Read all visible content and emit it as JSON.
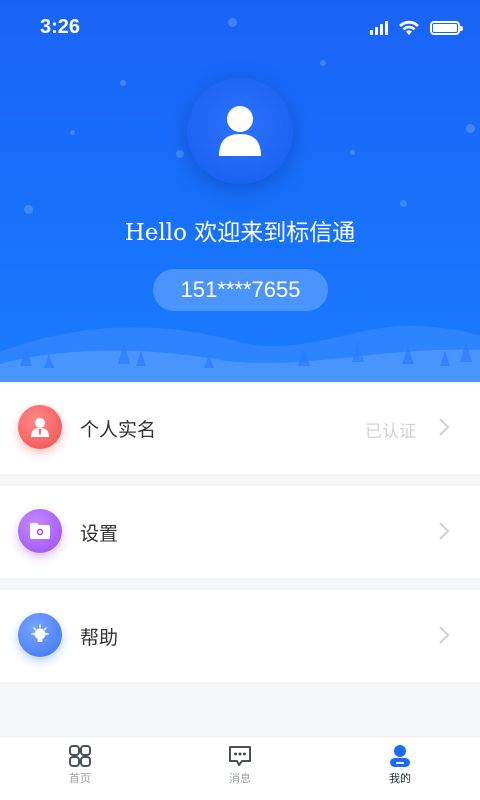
{
  "status_bar": {
    "time": "3:26"
  },
  "profile": {
    "greeting": "Hello 欢迎来到标信通",
    "phone": "151****7655",
    "avatar_icon": "user-avatar-icon"
  },
  "menu": [
    {
      "label": "个人实名",
      "status": "已认证",
      "icon": "id-card-icon",
      "color": "#f55a5a"
    },
    {
      "label": "设置",
      "status": "",
      "icon": "folder-gear-icon",
      "color": "#a95cf5"
    },
    {
      "label": "帮助",
      "status": "",
      "icon": "lightbulb-icon",
      "color": "#4d82f5"
    }
  ],
  "tabs": [
    {
      "label": "首页",
      "icon": "home-grid-icon",
      "active": false
    },
    {
      "label": "消息",
      "icon": "message-icon",
      "active": false
    },
    {
      "label": "我的",
      "icon": "profile-icon",
      "active": true
    }
  ],
  "colors": {
    "header_blue": "#1a63f6",
    "accent": "#1a6cf8"
  }
}
